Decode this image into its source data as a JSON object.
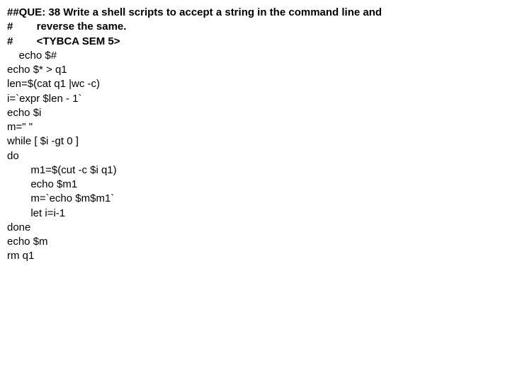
{
  "lines": [
    {
      "text": "##QUE: 38 Write a shell scripts to accept a string in the command line and",
      "bold": true
    },
    {
      "text": "#        reverse the same.",
      "bold": true
    },
    {
      "text": "#        <TYBCA SEM 5>",
      "bold": true
    },
    {
      "text": "    echo $#",
      "bold": false
    },
    {
      "text": "echo $* > q1",
      "bold": false
    },
    {
      "text": "len=$(cat q1 |wc -c)",
      "bold": false
    },
    {
      "text": "i=`expr $len - 1`",
      "bold": false
    },
    {
      "text": "echo $i",
      "bold": false
    },
    {
      "text": "m=\" \"",
      "bold": false
    },
    {
      "text": "while [ $i -gt 0 ]",
      "bold": false
    },
    {
      "text": "do",
      "bold": false
    },
    {
      "text": "        m1=$(cut -c $i q1)",
      "bold": false
    },
    {
      "text": "        echo $m1",
      "bold": false
    },
    {
      "text": "        m=`echo $m$m1`",
      "bold": false
    },
    {
      "text": "        let i=i-1",
      "bold": false
    },
    {
      "text": "done",
      "bold": false
    },
    {
      "text": "echo $m",
      "bold": false
    },
    {
      "text": "rm q1",
      "bold": false
    }
  ]
}
